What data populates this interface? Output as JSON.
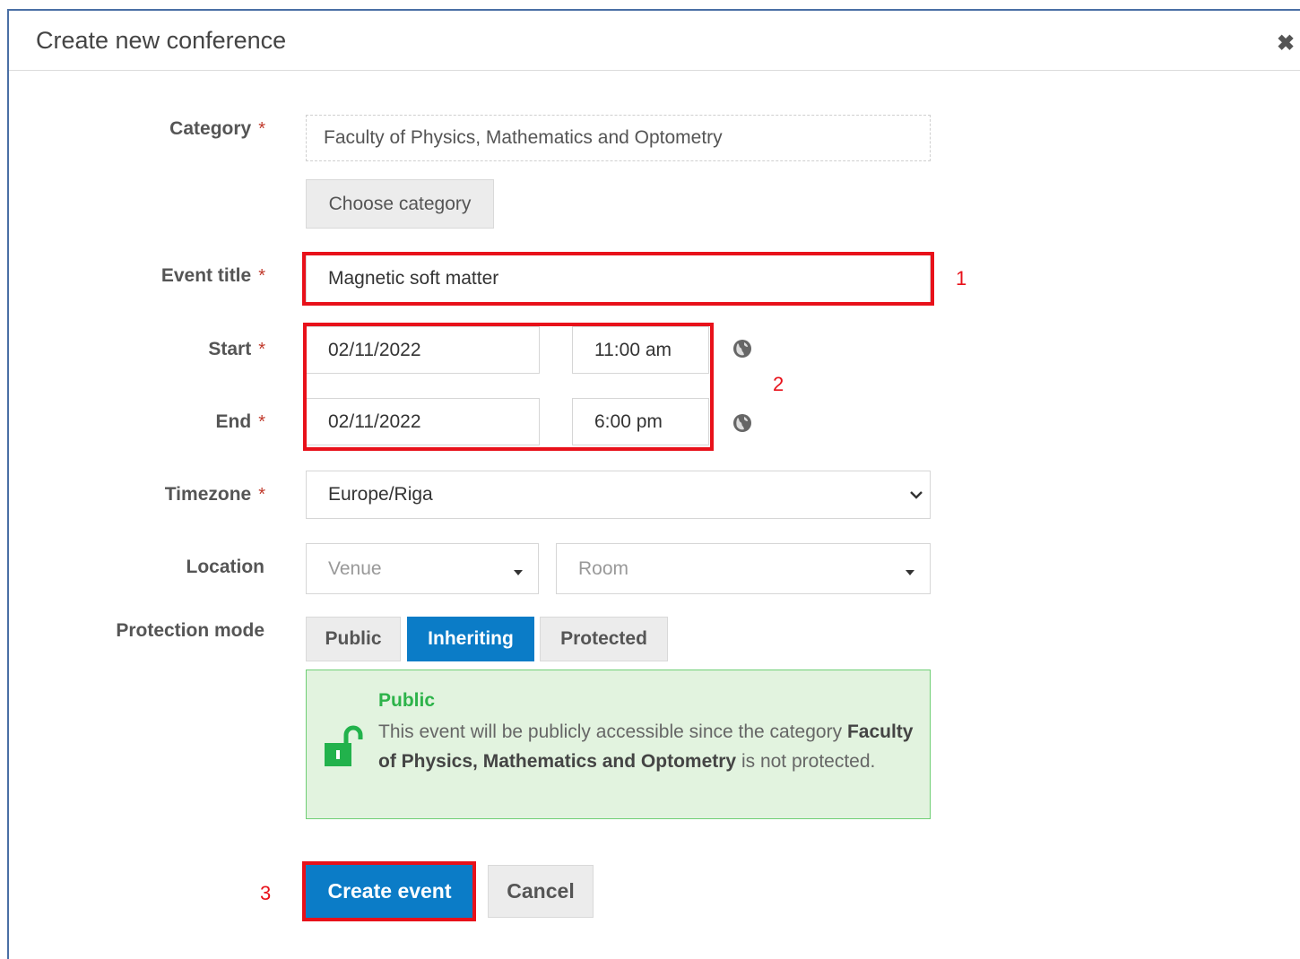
{
  "dialog": {
    "title": "Create new conference",
    "close_glyph": "✖"
  },
  "labels": {
    "category": "Category",
    "event_title": "Event title",
    "start": "Start",
    "end": "End",
    "timezone": "Timezone",
    "location": "Location",
    "protection_mode": "Protection mode",
    "required_mark": "*"
  },
  "category": {
    "value": "Faculty of Physics, Mathematics and Optometry",
    "choose_button": "Choose category"
  },
  "event_title": {
    "value": "Magnetic soft matter"
  },
  "start": {
    "date": "02/11/2022",
    "time": "11:00 am"
  },
  "end": {
    "date": "02/11/2022",
    "time": "6:00 pm"
  },
  "timezone": {
    "value": "Europe/Riga"
  },
  "location": {
    "venue_placeholder": "Venue",
    "room_placeholder": "Room"
  },
  "protection": {
    "options": [
      "Public",
      "Inheriting",
      "Protected"
    ],
    "selected": "Inheriting",
    "info_title": "Public",
    "info_text_before": "This event will be publicly accessible since the category",
    "info_category": "Faculty of Physics, Mathematics and Optometry",
    "info_text_after": "is not protected."
  },
  "actions": {
    "create": "Create event",
    "cancel": "Cancel"
  },
  "annotations": [
    "1",
    "2",
    "3"
  ],
  "colors": {
    "primary": "#0b7cc7",
    "annotation": "#e8111a",
    "success": "#2db34a",
    "required": "#c0392b"
  },
  "icons": {
    "globe": "globe-icon",
    "lock": "unlock-icon",
    "caret": "caret-down-icon",
    "close": "close-icon",
    "chevron": "chevron-down-icon"
  }
}
